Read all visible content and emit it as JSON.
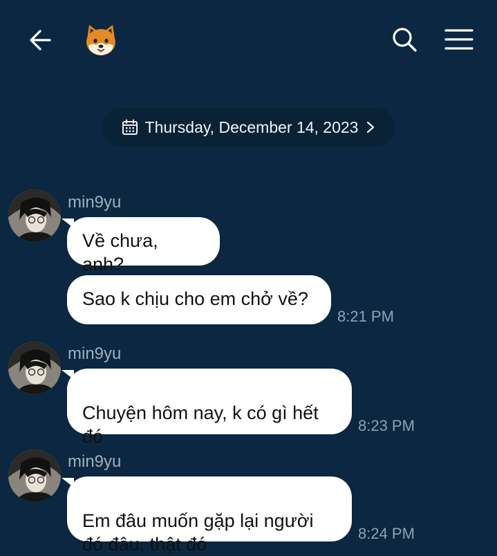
{
  "header": {
    "back_icon": "arrow-left-icon",
    "chat_avatar_emoji": "🐶",
    "search_icon": "search-icon",
    "menu_icon": "hamburger-menu-icon"
  },
  "date_chip": {
    "label": "Thursday, December 14, 2023",
    "calendar_icon": "calendar-icon",
    "chevron_icon": "chevron-right-icon"
  },
  "messages": [
    {
      "sender": "min9yu",
      "bubbles": [
        "Về chưa, anh?",
        "Sao k chịu cho em chở về?"
      ],
      "time": "8:21 PM"
    },
    {
      "sender": "min9yu",
      "bubbles": [
        "Chuyện hôm nay, k có gì hết\nđó"
      ],
      "time": "8:23 PM"
    },
    {
      "sender": "min9yu",
      "bubbles": [
        "Em đâu muốn gặp lại người\nđó đâu, thật đó"
      ],
      "time": "8:24 PM"
    }
  ],
  "colors": {
    "background": "#0b2741",
    "bubble": "#ffffff",
    "date_pill": "#0a2236",
    "username": "#9fb0bf",
    "time": "#8fa2b3"
  }
}
